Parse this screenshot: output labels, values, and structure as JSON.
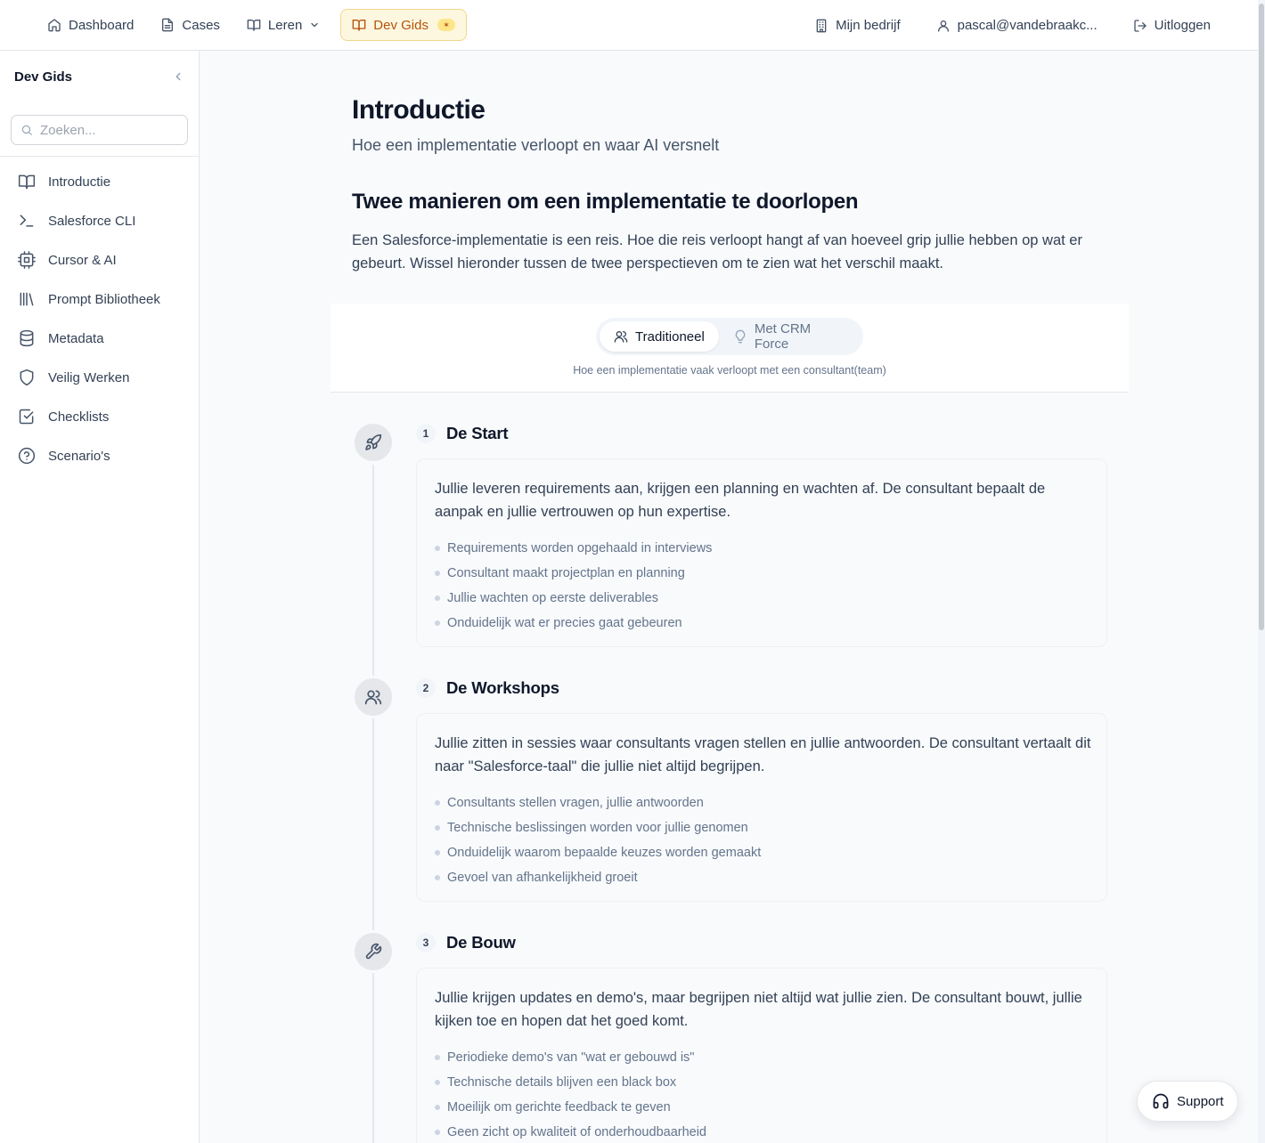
{
  "topnav": {
    "items": [
      {
        "label": "Dashboard",
        "icon": "home-icon"
      },
      {
        "label": "Cases",
        "icon": "file-icon"
      },
      {
        "label": "Leren",
        "icon": "book-icon"
      },
      {
        "label": "Dev Gids",
        "icon": "book-open-icon",
        "badge": "✶"
      }
    ],
    "right": [
      {
        "label": "Mijn bedrijf",
        "icon": "building-icon"
      },
      {
        "label": "pascal@vandebraakc...",
        "icon": "user-icon"
      },
      {
        "label": "Uitloggen",
        "icon": "logout-icon"
      }
    ],
    "accent": "#b45309"
  },
  "sidebar": {
    "title": "Dev Gids",
    "search_placeholder": "Zoeken...",
    "items": [
      {
        "label": "Introductie",
        "icon": "book-open-icon"
      },
      {
        "label": "Salesforce CLI",
        "icon": "terminal-icon"
      },
      {
        "label": "Cursor & AI",
        "icon": "cpu-icon"
      },
      {
        "label": "Prompt Bibliotheek",
        "icon": "library-icon"
      },
      {
        "label": "Metadata",
        "icon": "database-icon"
      },
      {
        "label": "Veilig Werken",
        "icon": "shield-icon"
      },
      {
        "label": "Checklists",
        "icon": "check-square-icon"
      },
      {
        "label": "Scenario's",
        "icon": "help-circle-icon"
      }
    ]
  },
  "main": {
    "title": "Introductie",
    "subtitle": "Hoe een implementatie verloopt en waar AI versnelt",
    "section_title": "Twee manieren om een implementatie te doorlopen",
    "lead": "Een Salesforce-implementatie is een reis. Hoe die reis verloopt hangt af van hoeveel grip jullie hebben op wat er gebeurt. Wissel hieronder tussen de twee perspectieven om te zien wat het verschil maakt.",
    "toggle": {
      "options": [
        {
          "label": "Traditioneel",
          "icon": "users-icon",
          "selected": true
        },
        {
          "label": "Met CRM Force",
          "icon": "lightbulb-icon",
          "selected": false
        }
      ],
      "caption": "Hoe een implementatie vaak verloopt met een consultant(team)"
    },
    "steps": [
      {
        "number": "1",
        "title": "De Start",
        "icon": "rocket-icon",
        "text": "Jullie leveren requirements aan, krijgen een planning en wachten af. De consultant bepaalt de aanpak en jullie vertrouwen op hun expertise.",
        "bullets": [
          "Requirements worden opgehaald in interviews",
          "Consultant maakt projectplan en planning",
          "Jullie wachten op eerste deliverables",
          "Onduidelijk wat er precies gaat gebeuren"
        ]
      },
      {
        "number": "2",
        "title": "De Workshops",
        "icon": "users-icon",
        "text": "Jullie zitten in sessies waar consultants vragen stellen en jullie antwoorden. De consultant vertaalt dit naar \"Salesforce-taal\" die jullie niet altijd begrijpen.",
        "bullets": [
          "Consultants stellen vragen, jullie antwoorden",
          "Technische beslissingen worden voor jullie genomen",
          "Onduidelijk waarom bepaalde keuzes worden gemaakt",
          "Gevoel van afhankelijkheid groeit"
        ]
      },
      {
        "number": "3",
        "title": "De Bouw",
        "icon": "wrench-icon",
        "text": "Jullie krijgen updates en demo's, maar begrijpen niet altijd wat jullie zien. De consultant bouwt, jullie kijken toe en hopen dat het goed komt.",
        "bullets": [
          "Periodieke demo's van \"wat er gebouwd is\"",
          "Technische details blijven een black box",
          "Moeilijk om gerichte feedback te geven",
          "Geen zicht op kwaliteit of onderhoudbaarheid"
        ]
      }
    ]
  },
  "support": {
    "label": "Support",
    "icon": "headphones-icon"
  }
}
